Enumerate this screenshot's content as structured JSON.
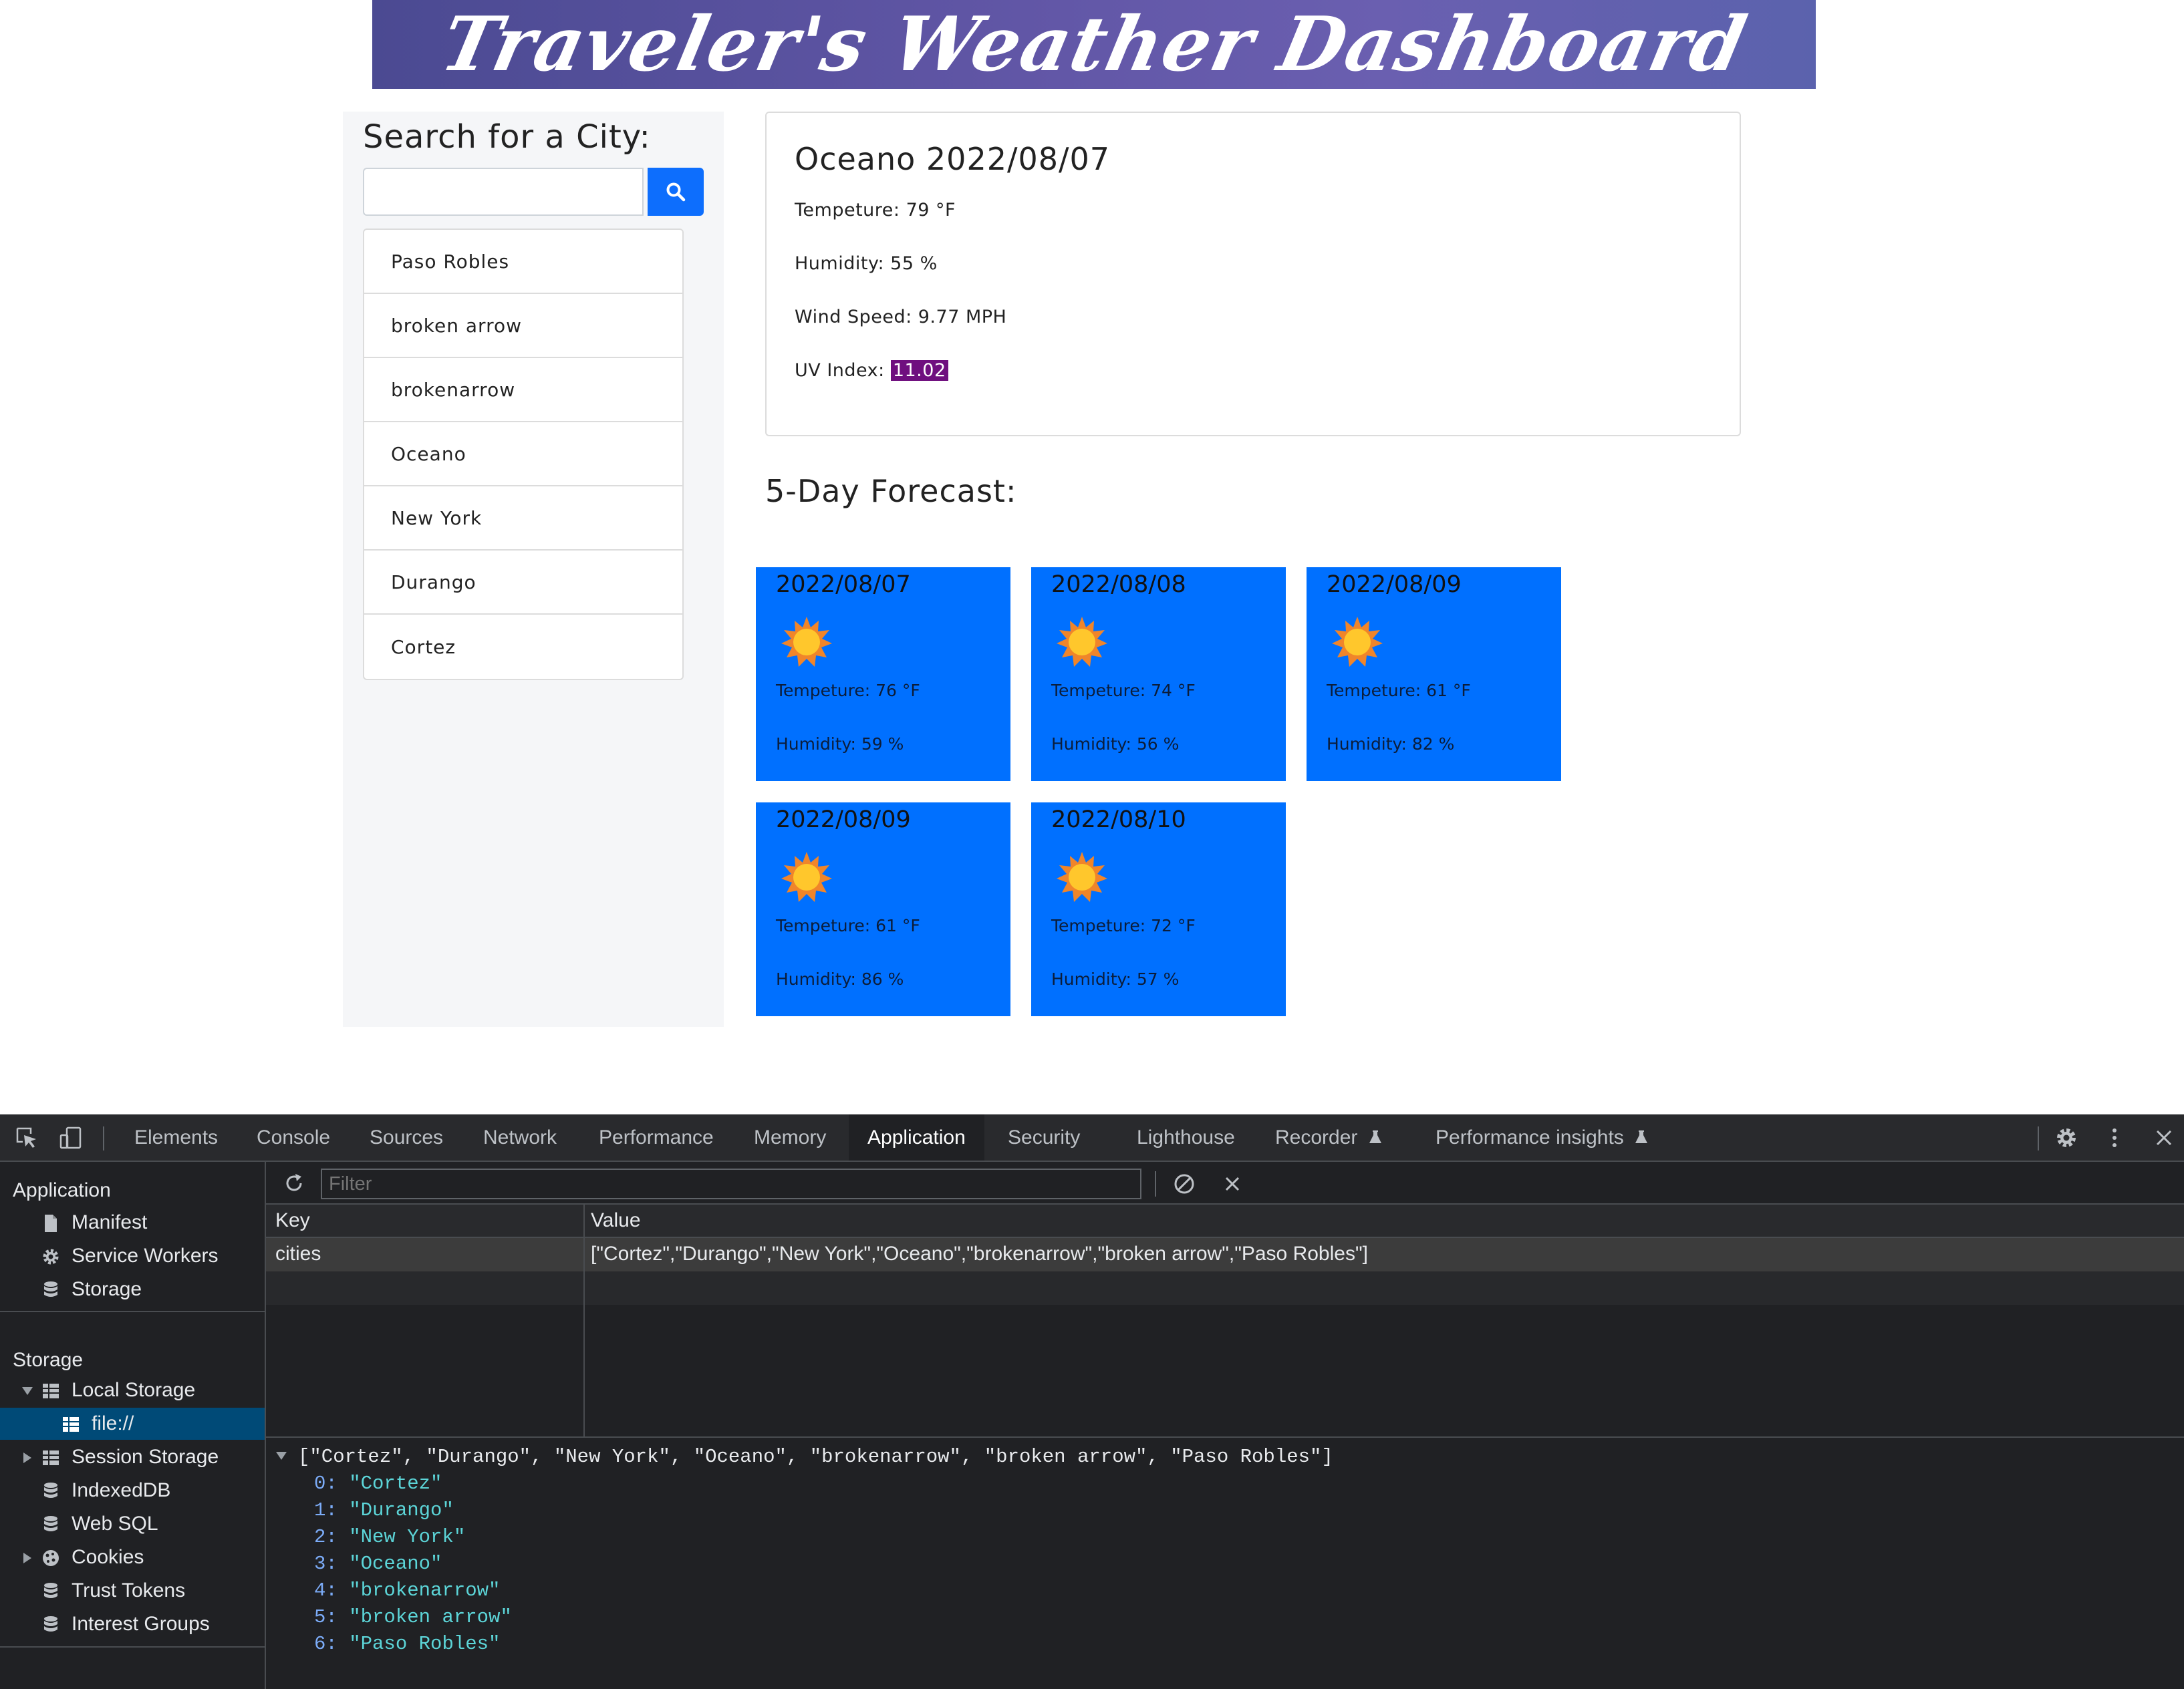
{
  "header": {
    "title": "Traveler's Weather Dashboard"
  },
  "sidebar": {
    "search_title": "Search for a City:",
    "search_value": "",
    "cities": [
      "Paso Robles",
      "broken arrow",
      "brokenarrow",
      "Oceano",
      "New York",
      "Durango",
      "Cortez"
    ]
  },
  "current": {
    "title": "Oceano 2022/08/07",
    "temp": "Tempeture: 79 °F",
    "humidity": "Humidity: 55 %",
    "wind": "Wind Speed: 9.77 MPH",
    "uv_label": "UV Index: ",
    "uv_value": "11.02",
    "uv_color": "#6f0f7f"
  },
  "forecast": {
    "title": "5-Day Forecast:",
    "card_color": "#0070ff",
    "icon": "sun-icon",
    "days": [
      {
        "date": "2022/08/07",
        "temp": "Tempeture: 76 °F",
        "humidity": "Humidity: 59 %"
      },
      {
        "date": "2022/08/08",
        "temp": "Tempeture: 74 °F",
        "humidity": "Humidity: 56 %"
      },
      {
        "date": "2022/08/09",
        "temp": "Tempeture: 61 °F",
        "humidity": "Humidity: 82 %"
      },
      {
        "date": "2022/08/09",
        "temp": "Tempeture: 61 °F",
        "humidity": "Humidity: 86 %"
      },
      {
        "date": "2022/08/10",
        "temp": "Tempeture: 72 °F",
        "humidity": "Humidity: 57 %"
      }
    ]
  },
  "devtools": {
    "tabs": [
      "Elements",
      "Console",
      "Sources",
      "Network",
      "Performance",
      "Memory",
      "Application",
      "Security",
      "Lighthouse",
      "Recorder",
      "Performance insights"
    ],
    "active_tab": "Application",
    "sidebar": {
      "application_header": "Application",
      "application_items": [
        "Manifest",
        "Service Workers",
        "Storage"
      ],
      "storage_header": "Storage",
      "local_storage": "Local Storage",
      "local_storage_child": "file://",
      "storage_items": [
        "Session Storage",
        "IndexedDB",
        "Web SQL",
        "Cookies",
        "Trust Tokens",
        "Interest Groups"
      ]
    },
    "filter_placeholder": "Filter",
    "columns": [
      "Key",
      "Value"
    ],
    "rows": [
      {
        "key": "cities",
        "value": "[\"Cortez\",\"Durango\",\"New York\",\"Oceano\",\"brokenarrow\",\"broken arrow\",\"Paso Robles\"]"
      }
    ],
    "preview": {
      "summary": "[\"Cortez\", \"Durango\", \"New York\", \"Oceano\", \"brokenarrow\", \"broken arrow\", \"Paso Robles\"]",
      "entries": [
        {
          "index": "0:",
          "value": "\"Cortez\""
        },
        {
          "index": "1:",
          "value": "\"Durango\""
        },
        {
          "index": "2:",
          "value": "\"New York\""
        },
        {
          "index": "3:",
          "value": "\"Oceano\""
        },
        {
          "index": "4:",
          "value": "\"brokenarrow\""
        },
        {
          "index": "5:",
          "value": "\"broken arrow\""
        },
        {
          "index": "6:",
          "value": "\"Paso Robles\""
        }
      ]
    }
  }
}
